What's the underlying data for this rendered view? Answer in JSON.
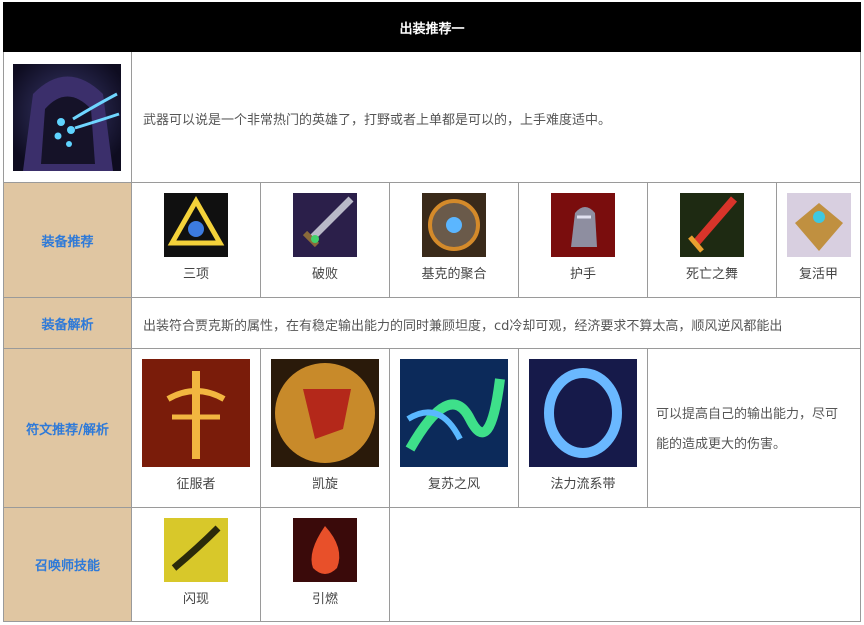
{
  "header": {
    "title": "出装推荐一"
  },
  "intro": {
    "portrait_icon": "hooded-champion-portrait-icon",
    "text": "武器可以说是一个非常热门的英雄了，打野或者上单都是可以的，上手难度适中。"
  },
  "items_section": {
    "label": "装备推荐",
    "items": [
      {
        "name": "三项",
        "icon": "triforce-icon"
      },
      {
        "name": "破败",
        "icon": "ruined-king-sword-icon"
      },
      {
        "name": "基克的聚合",
        "icon": "zekes-convergence-icon"
      },
      {
        "name": "护手",
        "icon": "gauntlet-icon"
      },
      {
        "name": "死亡之舞",
        "icon": "deaths-dance-icon"
      },
      {
        "name": "复活甲",
        "icon": "guardian-angel-icon"
      }
    ]
  },
  "analysis": {
    "label": "装备解析",
    "text": "出装符合贾克斯的属性，在有稳定输出能力的同时兼顾坦度，cd冷却可观，经济要求不算太高，顺风逆风都能出"
  },
  "runes": {
    "label": "符文推荐/解析",
    "items": [
      {
        "name": "征服者",
        "icon": "conqueror-rune-icon"
      },
      {
        "name": "凯旋",
        "icon": "triumph-rune-icon"
      },
      {
        "name": "复苏之风",
        "icon": "second-wind-rune-icon"
      },
      {
        "name": "法力流系带",
        "icon": "manaflow-band-rune-icon"
      }
    ],
    "note": "可以提高自己的输出能力，尽可能的造成更大的伤害。"
  },
  "summoners": {
    "label": "召唤师技能",
    "items": [
      {
        "name": "闪现",
        "icon": "flash-spell-icon"
      },
      {
        "name": "引燃",
        "icon": "ignite-spell-icon"
      }
    ]
  }
}
